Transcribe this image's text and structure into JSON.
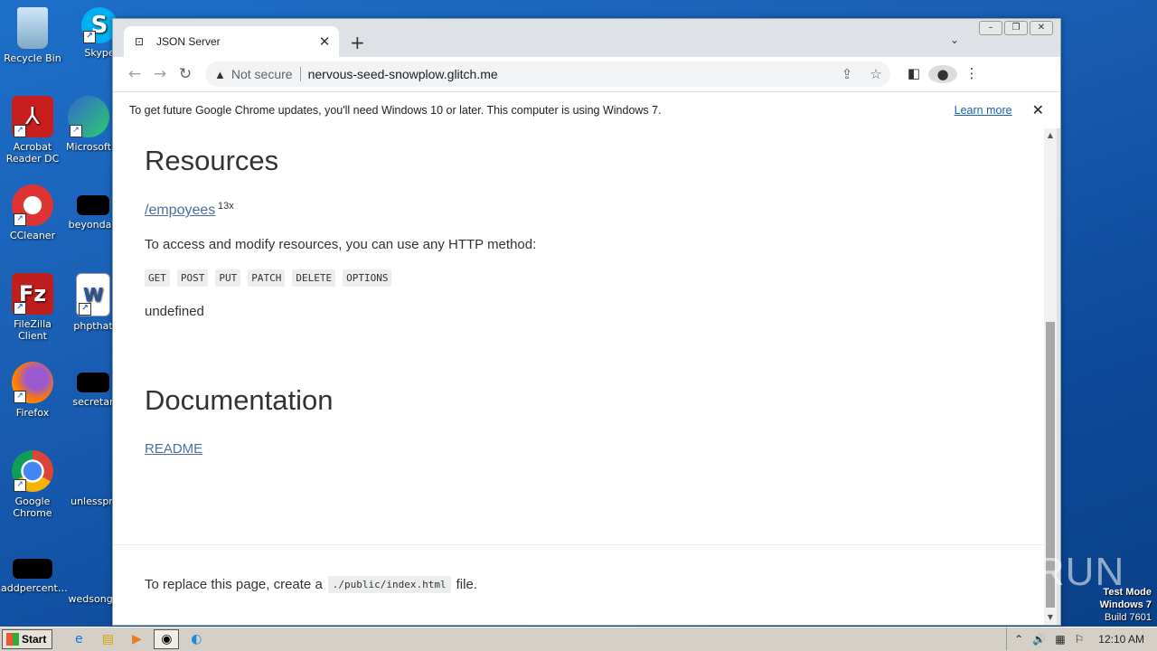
{
  "desktop": {
    "icons": [
      {
        "label": "Recycle Bin",
        "icon": "recycle-bin-icon"
      },
      {
        "label": "Skype",
        "icon": "skype-icon"
      },
      {
        "label": "Acrobat Reader DC",
        "icon": "acrobat-icon"
      },
      {
        "label": "Microsoft",
        "icon": "edge-icon"
      },
      {
        "label": "CCleaner",
        "icon": "ccleaner-icon"
      },
      {
        "label": "beyondag",
        "icon": "file-icon"
      },
      {
        "label": "FileZilla Client",
        "icon": "filezilla-icon"
      },
      {
        "label": "phpthat",
        "icon": "word-icon"
      },
      {
        "label": "Firefox",
        "icon": "firefox-icon"
      },
      {
        "label": "secretar",
        "icon": "file-icon"
      },
      {
        "label": "Google Chrome",
        "icon": "chrome-icon"
      },
      {
        "label": "unlesspri",
        "icon": "file-icon"
      },
      {
        "label": "addpercent…",
        "icon": "file-icon"
      },
      {
        "label": "wedsongs",
        "icon": "file-icon"
      }
    ]
  },
  "browser": {
    "tab_title": "JSON Server",
    "new_tab": "+",
    "address": {
      "security_label": "Not secure",
      "url": "nervous-seed-snowplow.glitch.me"
    },
    "infobar": {
      "message": "To get future Google Chrome updates, you'll need Windows 10 or later. This computer is using Windows 7.",
      "link": "Learn more"
    }
  },
  "page": {
    "resources_heading": "Resources",
    "resource_link": "/empoyees",
    "resource_count": "13x",
    "access_text": "To access and modify resources, you can use any HTTP method:",
    "methods": [
      "GET",
      "POST",
      "PUT",
      "PATCH",
      "DELETE",
      "OPTIONS"
    ],
    "undefined_text": "undefined",
    "documentation_heading": "Documentation",
    "readme_link": "README",
    "footer_prefix": "To replace this page, create a",
    "footer_code": "./public/index.html",
    "footer_suffix": "file."
  },
  "watermark": "ANY RUN",
  "system": {
    "test_mode": "Test Mode",
    "os_name": "Windows 7",
    "build": "Build 7601",
    "start_label": "Start",
    "clock": "12:10 AM"
  }
}
